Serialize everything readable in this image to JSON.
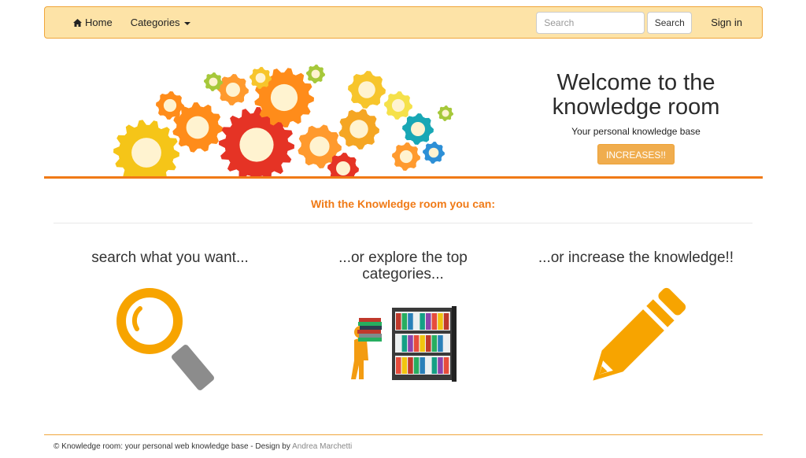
{
  "nav": {
    "home_label": "Home",
    "categories_label": "Categories",
    "search_placeholder": "Search",
    "search_button": "Search",
    "signin_label": "Sign in"
  },
  "hero": {
    "title": "Welcome to the knowledge room",
    "subtitle": "Your personal knowledge base",
    "button_label": "INCREASES!!"
  },
  "main": {
    "subheading": "With the Knowledge room you can:",
    "columns": [
      {
        "title": "search what you want...",
        "icon": "magnifier-icon"
      },
      {
        "title": "...or explore the top categories...",
        "icon": "bookshelf-illustration"
      },
      {
        "title": "...or increase the knowledge!!",
        "icon": "pencil-icon"
      }
    ]
  },
  "footer": {
    "text": "© Knowledge room: your personal web knowledge base - Design by ",
    "author": "Andrea Marchetti"
  },
  "colors": {
    "accent_orange": "#f07a16",
    "navbar_bg": "#fde3a7",
    "button_orange": "#f0ad4e",
    "icon_orange": "#f7a400"
  }
}
